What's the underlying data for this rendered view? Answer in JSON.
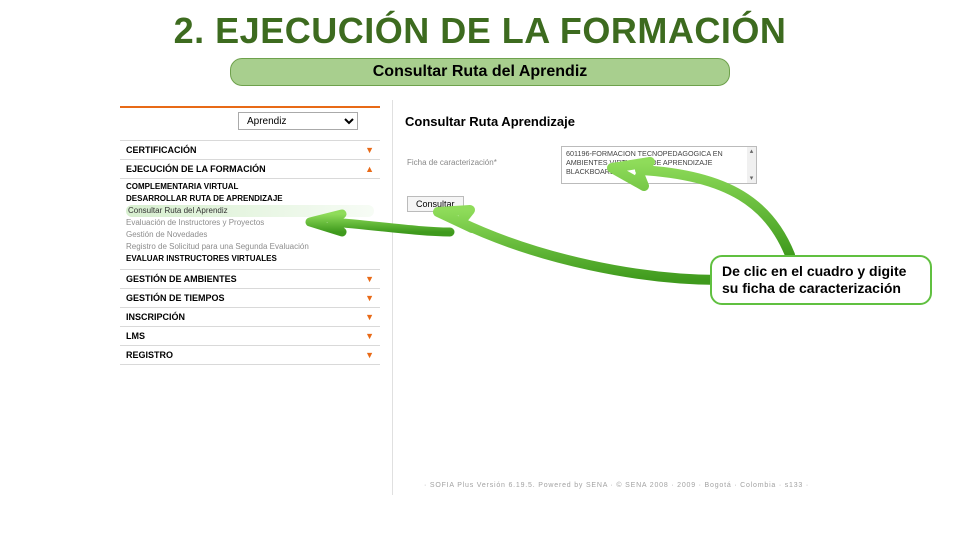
{
  "title": "2. EJECUCIÓN DE LA FORMACIÓN",
  "subtitle": "Consultar Ruta del Aprendiz",
  "role_selector": {
    "value": "Aprendiz"
  },
  "nav": {
    "certificacion": "CERTIFICACIÓN",
    "ejecucion": "EJECUCIÓN DE LA FORMACIÓN",
    "complementaria": "COMPLEMENTARIA VIRTUAL",
    "desarrollar": "DESARROLLAR RUTA DE APRENDIZAJE",
    "sub": {
      "consultar": "Consultar Ruta del Aprendiz",
      "evaluacion": "Evaluación de Instructores y Proyectos",
      "gestion_nov": "Gestión de Novedades",
      "registro": "Registro de Solicitud para una Segunda Evaluación"
    },
    "evaluar": "EVALUAR INSTRUCTORES VIRTUALES",
    "gestion_amb": "GESTIÓN DE AMBIENTES",
    "gestion_tiempos": "GESTIÓN DE TIEMPOS",
    "inscripcion": "INSCRIPCIÓN",
    "lms": "LMS",
    "registro_nav": "REGISTRO"
  },
  "right": {
    "title": "Consultar Ruta Aprendizaje",
    "ficha_label": "Ficha de caracterización*",
    "ficha_value": "601196-FORMACION TECNOPEDAGOGICA EN AMBIENTES VIRTUALES DE APRENDIZAJE BLACKBOARD 9.1",
    "consultar_btn": "Consultar"
  },
  "callout": "De clic en el cuadro y digite su ficha de caracterización",
  "footer": "· SOFIA Plus Versión 6.19.5. Powered by SENA · © SENA 2008 · 2009 · Bogotá · Colombia · s133 ·"
}
